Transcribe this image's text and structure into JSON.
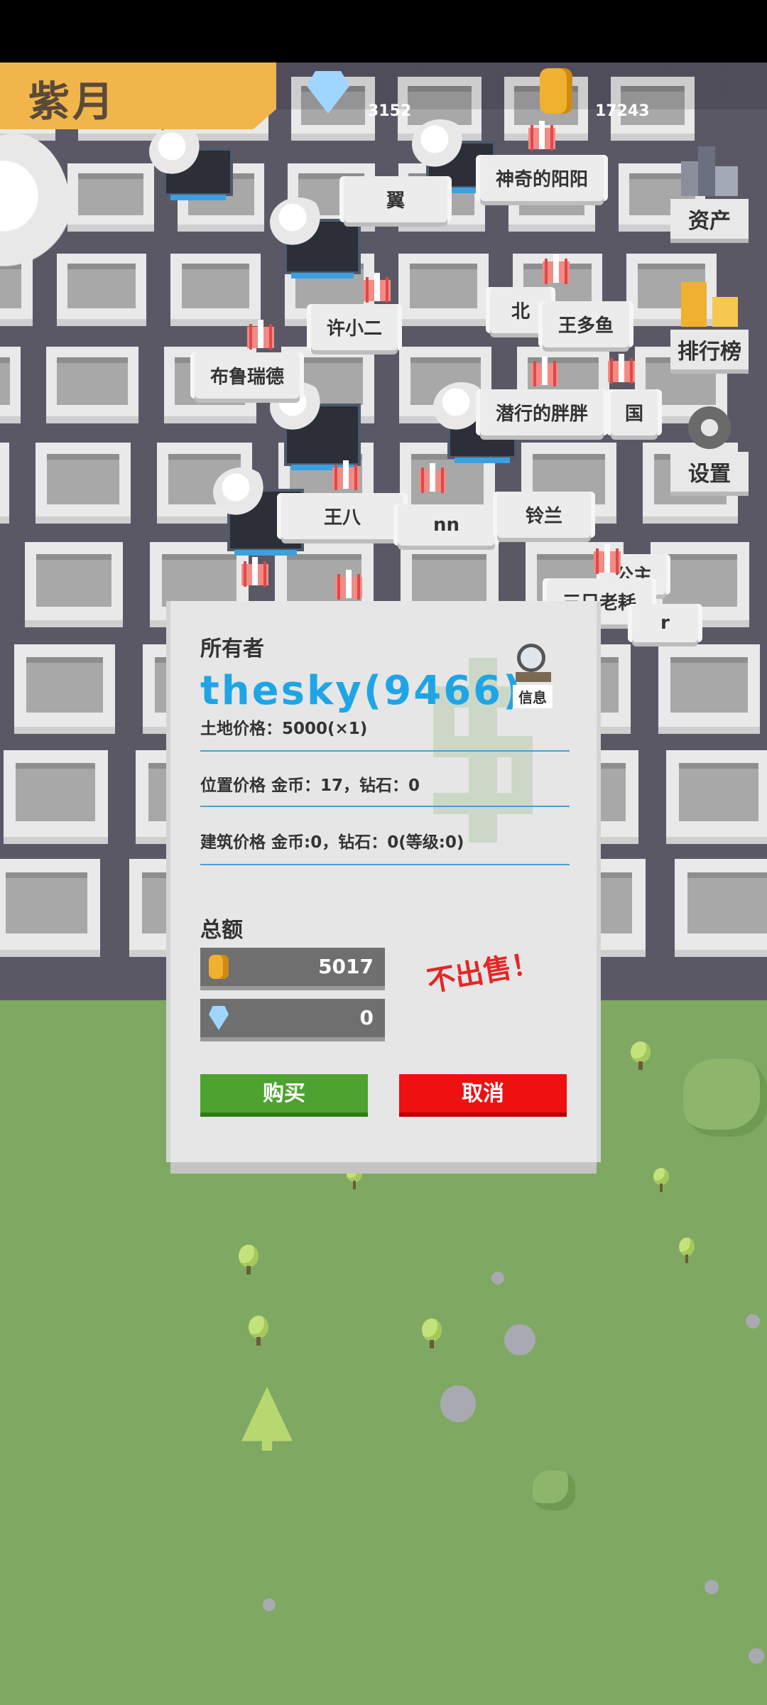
{
  "header": {
    "player_name": "紫月",
    "diamonds": "3152",
    "coins": "17243"
  },
  "side_menu": {
    "assets": "资产",
    "leaderboard": "排行榜",
    "settings": "设置"
  },
  "map_labels": [
    "翼",
    "神奇的阳阳",
    "许小二",
    "北",
    "王多鱼",
    "布鲁瑞德",
    "潜行的胖胖",
    "国",
    "王八",
    "nn",
    "铃兰",
    "公主",
    "三只老耗",
    "r"
  ],
  "dialog": {
    "owner_label": "所有者",
    "owner_name": "thesky(9466)",
    "info_label": "信息",
    "land_price": "土地价格：5000(×1)",
    "location_price": "位置价格 金币：17，钻石：0",
    "building_price": "建筑价格 金币:0，钻石：0(等级:0)",
    "total_label": "总额",
    "total_coins": "5017",
    "total_diamonds": "0",
    "not_for_sale": "不出售！",
    "buy_label": "购买",
    "cancel_label": "取消"
  }
}
